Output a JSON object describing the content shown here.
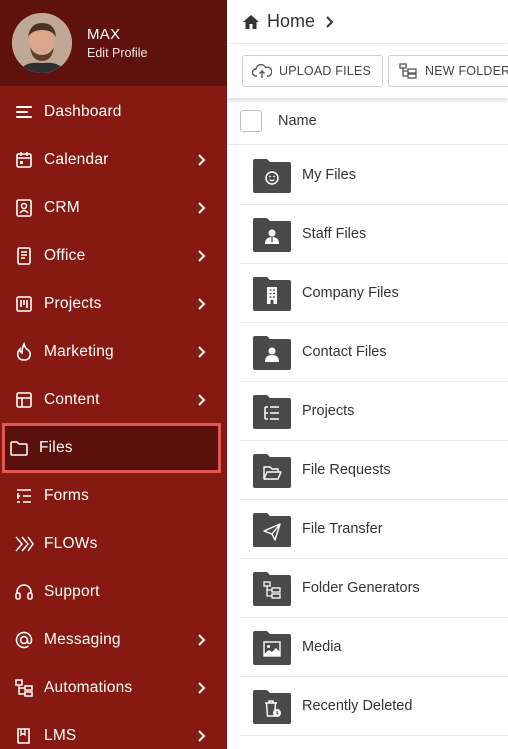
{
  "profile": {
    "name": "MAX",
    "edit_label": "Edit Profile"
  },
  "sidebar": {
    "items": [
      {
        "label": "Dashboard",
        "icon": "menu-lines-icon",
        "chevron": false
      },
      {
        "label": "Calendar",
        "icon": "calendar-icon",
        "chevron": true
      },
      {
        "label": "CRM",
        "icon": "contact-card-icon",
        "chevron": true
      },
      {
        "label": "Office",
        "icon": "document-icon",
        "chevron": true
      },
      {
        "label": "Projects",
        "icon": "kanban-icon",
        "chevron": true
      },
      {
        "label": "Marketing",
        "icon": "flame-icon",
        "chevron": true
      },
      {
        "label": "Content",
        "icon": "content-icon",
        "chevron": true
      },
      {
        "label": "Files",
        "icon": "folder-icon",
        "chevron": false,
        "active": true
      },
      {
        "label": "Forms",
        "icon": "form-list-icon",
        "chevron": false
      },
      {
        "label": "FLOWs",
        "icon": "flow-arrows-icon",
        "chevron": false
      },
      {
        "label": "Support",
        "icon": "headset-icon",
        "chevron": false
      },
      {
        "label": "Messaging",
        "icon": "at-sign-icon",
        "chevron": true
      },
      {
        "label": "Automations",
        "icon": "hierarchy-icon",
        "chevron": true
      },
      {
        "label": "LMS",
        "icon": "book-icon",
        "chevron": true
      }
    ]
  },
  "breadcrumb": {
    "home_label": "Home"
  },
  "toolbar": {
    "upload_label": "UPLOAD FILES",
    "new_folder_label": "NEW FOLDER"
  },
  "list": {
    "name_header": "Name",
    "folders": [
      {
        "label": "My Files",
        "icon": "smiley-folder-icon"
      },
      {
        "label": "Staff Files",
        "icon": "staff-folder-icon"
      },
      {
        "label": "Company Files",
        "icon": "building-folder-icon"
      },
      {
        "label": "Contact Files",
        "icon": "person-folder-icon"
      },
      {
        "label": "Projects",
        "icon": "tasks-folder-icon"
      },
      {
        "label": "File Requests",
        "icon": "open-folder-icon"
      },
      {
        "label": "File Transfer",
        "icon": "send-folder-icon"
      },
      {
        "label": "Folder Generators",
        "icon": "tree-folder-icon"
      },
      {
        "label": "Media",
        "icon": "image-folder-icon"
      },
      {
        "label": "Recently Deleted",
        "icon": "trash-folder-icon"
      }
    ]
  },
  "colors": {
    "sidebar_bg": "#861a12",
    "profile_bg": "#5f120d",
    "active_bg": "#5a100b",
    "active_border": "#e35454",
    "folder_icon": "#4a4a4a"
  }
}
